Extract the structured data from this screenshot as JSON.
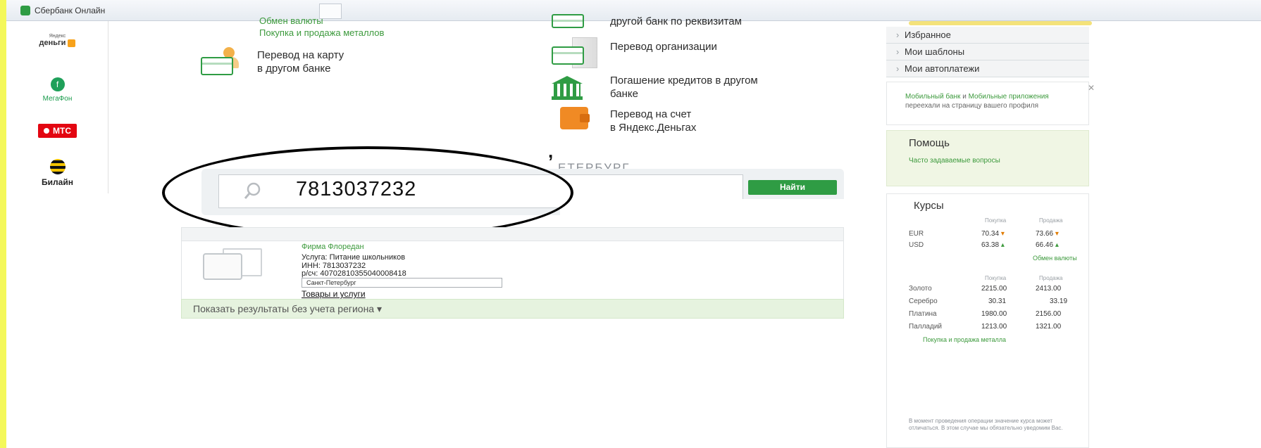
{
  "browser": {
    "tab_title": "Сбербанк Онлайн"
  },
  "operators": [
    {
      "small": "Яндекс",
      "name": "деньги"
    },
    {
      "name": "МегаФон"
    },
    {
      "name": "МТС"
    },
    {
      "name": "Билайн"
    }
  ],
  "top_links": [
    "Обмен валюты",
    "Покупка и продажа металлов"
  ],
  "services_left": [
    {
      "line1": "Перевод на карту",
      "line2": "в другом банке"
    }
  ],
  "services_right": [
    {
      "line1": "другой банк по реквизитам",
      "line2": ""
    },
    {
      "line1": "Перевод организации",
      "line2": ""
    },
    {
      "line1": "Погашение кредитов в другом",
      "line2": "банке"
    },
    {
      "line1": "Перевод на счет",
      "line2": "в Яндекс.Деньгах"
    }
  ],
  "region": {
    "label": "ЕТЕРБУРГ"
  },
  "search": {
    "value": "7813037232",
    "button_label": "Найти"
  },
  "result": {
    "name": "Фирма Флоредан",
    "service": "Услуга: Питание школьников",
    "inn": "ИНН: 7813037232",
    "account": "р/сч: 40702810355040008418",
    "region": "Санкт-Петербург",
    "goods_link": "Товары и услуги"
  },
  "show_all": "Показать результаты без учета региона",
  "sidebar": {
    "items": [
      "Избранное",
      "Мои шаблоны",
      "Мои автоплатежи"
    ],
    "note_link1": "Мобильный банк",
    "note_and": "и",
    "note_link2": "Мобильные приложения",
    "note_text": "переехали на страницу вашего профиля",
    "help_title": "Помощь",
    "help_link": "Часто задаваемые вопросы"
  },
  "rates": {
    "title": "Курсы",
    "head_buy": "Покупка",
    "head_sell": "Продажа",
    "currencies": [
      {
        "name": "EUR",
        "buy": "70.34",
        "sell": "73.66"
      },
      {
        "name": "USD",
        "buy": "63.38",
        "sell": "66.46"
      }
    ],
    "exchange_link": "Обмен валюты",
    "metals": [
      {
        "name": "Золото",
        "buy": "2215.00",
        "sell": "2413.00"
      },
      {
        "name": "Серебро",
        "buy": "30.31",
        "sell": "33.19"
      },
      {
        "name": "Платина",
        "buy": "1980.00",
        "sell": "2156.00"
      },
      {
        "name": "Палладий",
        "buy": "1213.00",
        "sell": "1321.00"
      }
    ],
    "metals_link": "Покупка и продажа металла",
    "note": "В момент проведения операции значение курса может отличаться. В этом случае мы обязательно уведомим Вас."
  },
  "colors": {
    "accent": "#2f9c44",
    "link": "#3d9a3d",
    "orange": "#f08a24"
  }
}
